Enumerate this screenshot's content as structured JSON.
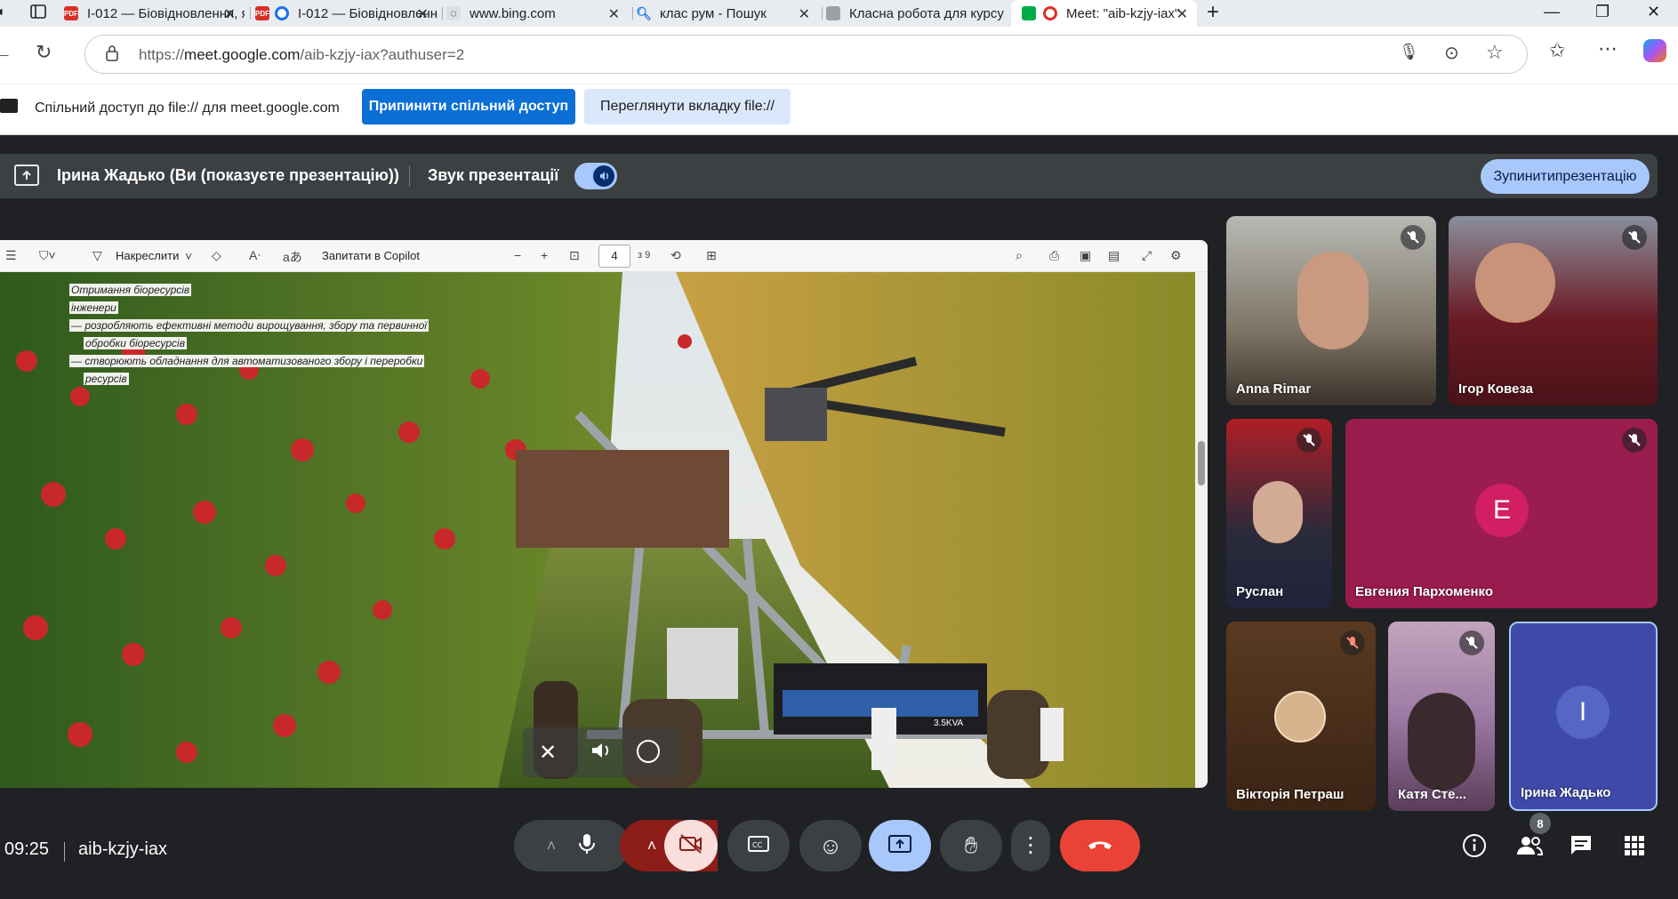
{
  "browser": {
    "tabs": [
      {
        "label": "І-012 — Біовідновлення, як",
        "favicon": "pdf-icon",
        "active": false
      },
      {
        "label": "І-012 — Біовідновлення",
        "favicon": "pdf-icon",
        "active": false
      },
      {
        "label": "www.bing.com",
        "favicon": "bing-icon",
        "active": false
      },
      {
        "label": "клас рум - Пошук",
        "favicon": "search-icon",
        "active": false
      },
      {
        "label": "Класна робота для курсу",
        "favicon": "classroom-icon",
        "active": false
      },
      {
        "label": "Meet: \"aib-kzjy-iax\"",
        "favicon": "meet-icon",
        "active": true
      }
    ],
    "url_prefix": "https://",
    "url_host": "meet.google.com",
    "url_path": "/aib-kzjy-iax?authuser=2"
  },
  "sharebar": {
    "message": "Спільний доступ до file:// для meet.google.com",
    "stop_label": "Припинити спільний доступ",
    "view_label": "Переглянути вкладку file://"
  },
  "presentation": {
    "title": "Ірина Жадько (Ви (показуєте презентацію))",
    "audio_label": "Звук презентації",
    "audio_on": true,
    "stop_line1": "Зупинити",
    "stop_line2": "презентацію"
  },
  "pdf_viewer": {
    "draw_label": "Накреслити",
    "copilot_label": "Запитати в Copilot",
    "page": "4",
    "total_pages": "з 9"
  },
  "slide": {
    "lines": [
      "Отримання біоресурсів",
      "інженери",
      "— розробляють ефективні методи вирощування, збору та первинної",
      "обробки біоресурсів",
      "— створюють обладнання для автоматизованого збору і переробки",
      "ресурсів"
    ],
    "engine_label": "3.5KVA"
  },
  "participants": [
    {
      "name": "Anna Rimar",
      "muted": true
    },
    {
      "name": "Ігор Ковеза",
      "muted": true
    },
    {
      "name": "Руслан",
      "muted": true
    },
    {
      "name": "Евгения Пархоменко",
      "initial": "E",
      "muted": true
    },
    {
      "name": "Вікторія Петраш",
      "muted": true
    },
    {
      "name": "Катя Сте...",
      "muted": true
    },
    {
      "name": "Ірина Жадько",
      "initial": "I",
      "muted": false
    }
  ],
  "meeting": {
    "time": "09:25",
    "code": "aib-kzjy-iax",
    "people_count": "8"
  },
  "colors": {
    "accent_blue": "#a8c7fa",
    "end_call_red": "#ea4335",
    "camera_off_red": "#f9dedc",
    "evgenia_tile": "#9b1c4f",
    "irina_tile": "#3f4aa8"
  }
}
